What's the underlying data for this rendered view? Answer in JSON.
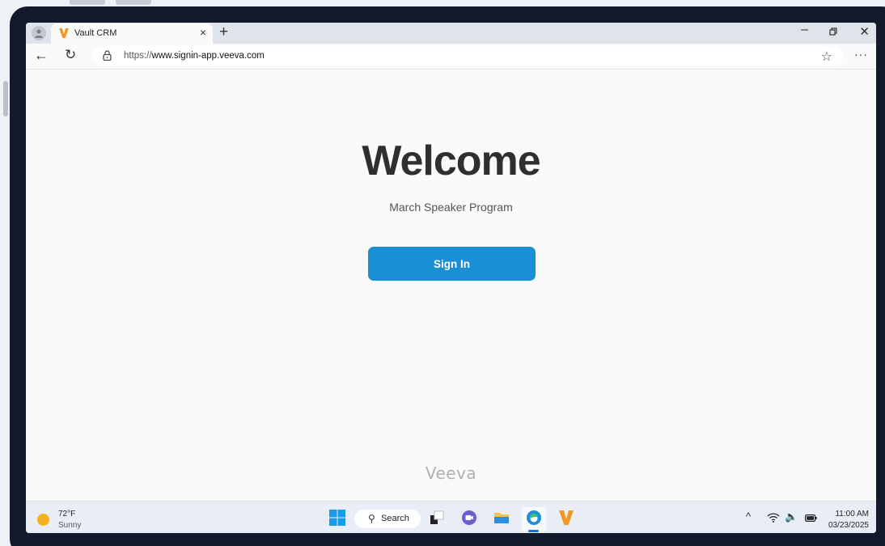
{
  "browser": {
    "tab_title": "Vault CRM",
    "new_tab_glyph": "+",
    "close_tab_glyph": "×",
    "url_prefix": "https://",
    "url_host": "www.signin-app.veeva.com"
  },
  "page": {
    "heading": "Welcome",
    "subtitle": "March Speaker Program",
    "signin_label": "Sign In",
    "footer_logo": "Veeva"
  },
  "taskbar": {
    "weather_temp": "72°F",
    "weather_desc": "Sunny",
    "search_label": "Search",
    "time": "11:00 AM",
    "date": "03/23/2025"
  },
  "colors": {
    "accent": "#1b8fd3",
    "veeva_orange": "#f39a1e",
    "bezel": "#141a2e"
  },
  "icons": [
    "profile-icon",
    "veeva-favicon",
    "back-arrow-icon",
    "reload-icon",
    "lock-icon",
    "star-icon",
    "more-icon",
    "windows-start-icon",
    "search-icon",
    "task-view-icon",
    "chat-icon",
    "file-explorer-icon",
    "edge-icon",
    "veeva-app-icon",
    "chevron-up-icon",
    "wifi-icon",
    "volume-icon",
    "battery-icon"
  ]
}
